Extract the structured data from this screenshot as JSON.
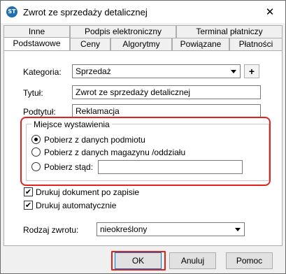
{
  "window": {
    "title": "Zwrot ze sprzedaży detalicznej",
    "app_icon_text": "ST",
    "close_glyph": "✕"
  },
  "tabs_row1": [
    {
      "label": "Inne"
    },
    {
      "label": "Podpis elektroniczny"
    },
    {
      "label": "Terminal płatniczy"
    }
  ],
  "tabs_row2": [
    {
      "label": "Podstawowe",
      "active": true
    },
    {
      "label": "Ceny"
    },
    {
      "label": "Algorytmy"
    },
    {
      "label": "Powiązane"
    },
    {
      "label": "Płatności"
    }
  ],
  "form": {
    "category_label": "Kategoria:",
    "category_value": "Sprzedaż",
    "plus_label": "+",
    "title_label": "Tytuł:",
    "title_value": "Zwrot ze sprzedaży detalicznej",
    "subtitle_label": "Podtytuł:",
    "subtitle_value": "Reklamacja"
  },
  "issue_place": {
    "legend": "Miejsce wystawienia",
    "options": [
      {
        "label": "Pobierz z danych podmiotu",
        "checked": true
      },
      {
        "label": "Pobierz z danych magazynu /oddziału",
        "checked": false
      },
      {
        "label": "Pobierz stąd:",
        "checked": false
      }
    ],
    "custom_value": ""
  },
  "checkboxes": [
    {
      "label": "Drukuj dokument po zapisie",
      "checked": true
    },
    {
      "label": "Drukuj automatycznie",
      "checked": true
    }
  ],
  "check_glyph": "✔",
  "return_type": {
    "label": "Rodzaj zwrotu:",
    "value": "nieokreślony"
  },
  "buttons": {
    "ok": "OK",
    "cancel": "Anuluj",
    "help": "Pomoc"
  },
  "colors": {
    "highlight": "#e2231a",
    "accent": "#0078d7"
  }
}
